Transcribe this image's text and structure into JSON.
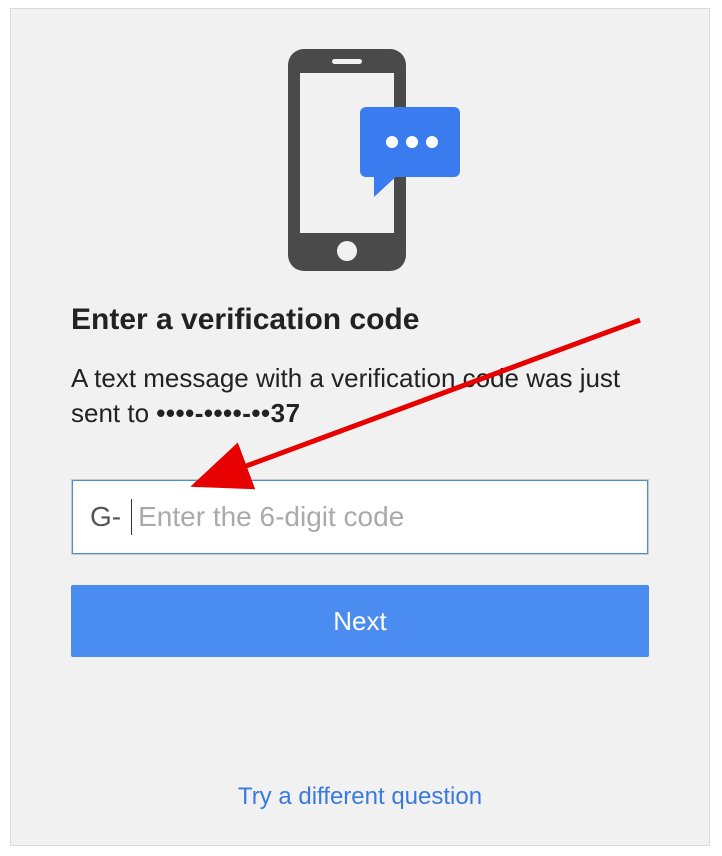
{
  "heading": "Enter a verification code",
  "description_prefix": "A text message with a verification code was just sent to ",
  "masked_number": "••••-••••-••37",
  "input": {
    "prefix": "G-",
    "placeholder": "Enter the 6-digit code"
  },
  "next_label": "Next",
  "alt_link_label": "Try a different question",
  "colors": {
    "primary": "#4a8cf0",
    "link": "#3a7adf",
    "arrow": "#e60000"
  }
}
